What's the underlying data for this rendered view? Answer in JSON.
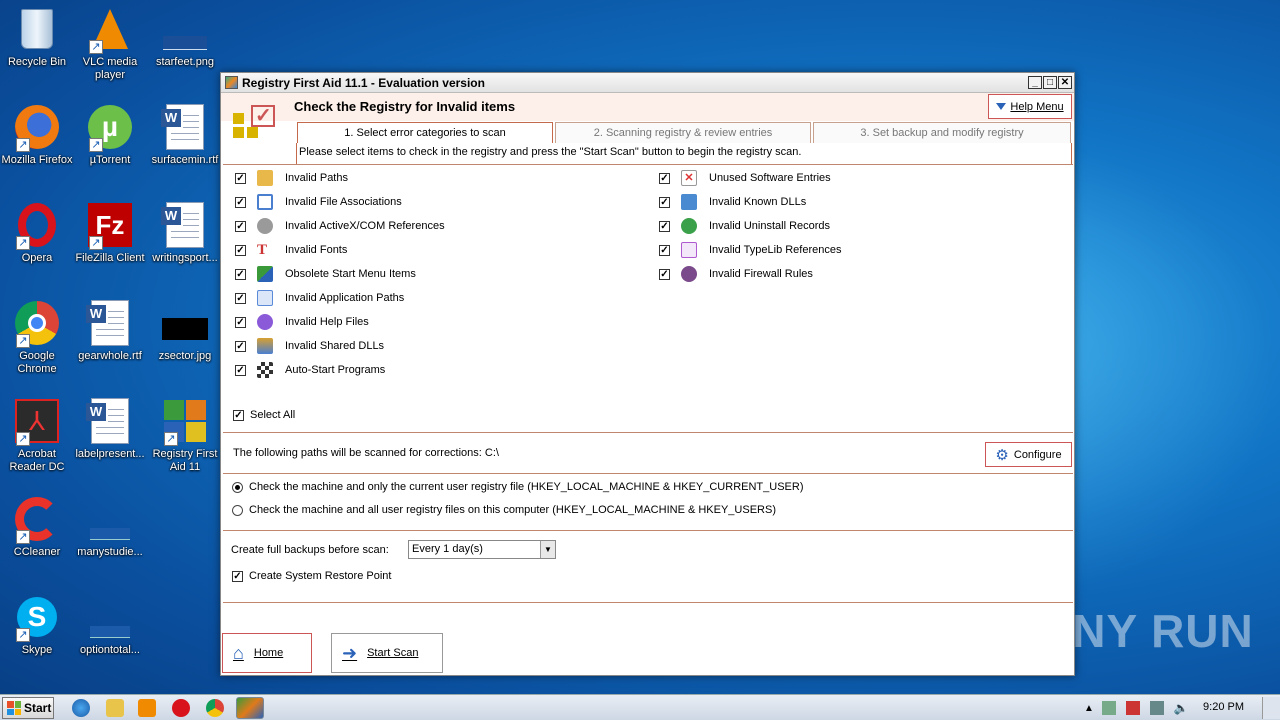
{
  "desktop": {
    "icons": [
      {
        "label": "Recycle Bin"
      },
      {
        "label": "VLC media player"
      },
      {
        "label": "starfeet.png"
      },
      {
        "label": "Mozilla Firefox"
      },
      {
        "label": "µTorrent"
      },
      {
        "label": "surfacemin.rtf"
      },
      {
        "label": "Opera"
      },
      {
        "label": "FileZilla Client"
      },
      {
        "label": "writingsport..."
      },
      {
        "label": "Google Chrome"
      },
      {
        "label": "gearwhole.rtf"
      },
      {
        "label": "zsector.jpg"
      },
      {
        "label": "Acrobat Reader DC"
      },
      {
        "label": "labelpresent..."
      },
      {
        "label": "Registry First Aid 11"
      },
      {
        "label": "CCleaner"
      },
      {
        "label": "manystudie..."
      },
      {
        "label": "Skype"
      },
      {
        "label": "optiontotal..."
      }
    ]
  },
  "window": {
    "title": "Registry First Aid 11.1 - Evaluation version",
    "header_title": "Check the Registry for Invalid items",
    "help_menu": "Help Menu",
    "tabs": [
      {
        "label": "1. Select error categories to scan"
      },
      {
        "label": "2. Scanning registry & review entries"
      },
      {
        "label": "3. Set backup and modify registry"
      }
    ],
    "instructions": "Please select items to check in the registry and press the \"Start Scan\" button to begin the registry scan.",
    "left_items": [
      {
        "label": "Invalid Paths",
        "color": "#e8b84a"
      },
      {
        "label": "Invalid File Associations",
        "color": "#4a7fd0"
      },
      {
        "label": "Invalid ActiveX/COM References",
        "color": "#9a9a9a"
      },
      {
        "label": "Invalid Fonts",
        "color": "#c33"
      },
      {
        "label": "Obsolete Start Menu Items",
        "color": "#3a9a3a"
      },
      {
        "label": "Invalid Application Paths",
        "color": "#5a8ad8"
      },
      {
        "label": "Invalid Help Files",
        "color": "#8a5ad8"
      },
      {
        "label": "Invalid Shared DLLs",
        "color": "#d8a030"
      },
      {
        "label": "Auto-Start Programs",
        "color": "#333"
      }
    ],
    "right_items": [
      {
        "label": "Unused Software Entries",
        "color": "#d33"
      },
      {
        "label": "Invalid Known DLLs",
        "color": "#4a8ad0"
      },
      {
        "label": "Invalid Uninstall Records",
        "color": "#3aa04a"
      },
      {
        "label": "Invalid TypeLib References",
        "color": "#b05ad0"
      },
      {
        "label": "Invalid Firewall Rules",
        "color": "#7a4a8a"
      }
    ],
    "select_all": "Select All",
    "paths_text": "The following paths will be scanned for corrections: C:\\",
    "configure": "Configure",
    "radio_current": "Check the machine and only the current user registry file (HKEY_LOCAL_MACHINE & HKEY_CURRENT_USER)",
    "radio_all": "Check the machine and all user registry files on this computer (HKEY_LOCAL_MACHINE & HKEY_USERS)",
    "backup_label": "Create full backups before scan:",
    "backup_value": "Every 1 day(s)",
    "restore_point": "Create System Restore Point",
    "home": "Home",
    "start_scan": "Start Scan"
  },
  "taskbar": {
    "start": "Start",
    "clock": "9:20 PM"
  },
  "watermark": "ANY RUN"
}
